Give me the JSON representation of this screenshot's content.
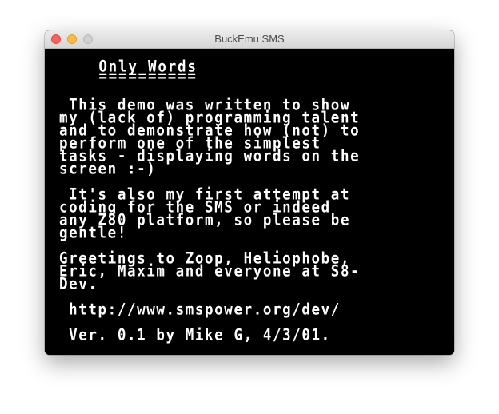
{
  "window": {
    "title": "BuckEmu SMS"
  },
  "screen": {
    "lines": [
      "    Only Words",
      "    ==========",
      "",
      " This demo was written to show",
      "my (lack of) programming talent",
      "and to demonstrate how (not) to",
      "perform one of the simplest",
      "tasks - displaying words on the",
      "screen :-)",
      "",
      " It's also my first attempt at",
      "coding for the SMS or indeed",
      "any Z80 platform, so please be",
      "gentle!",
      "",
      "Greetings to Zoop, Heliophobe,",
      "Eric, Maxim and everyone at S8-",
      "Dev.",
      "",
      " http://www.smspower.org/dev/",
      "",
      " Ver. 0.1 by Mike G, 4/3/01."
    ]
  },
  "colors": {
    "screen_background": "#000000",
    "screen_text": "#ffffff",
    "close_button": "#fc605c",
    "minimize_button": "#fdbc40",
    "zoom_button": "#d0d0d0"
  }
}
